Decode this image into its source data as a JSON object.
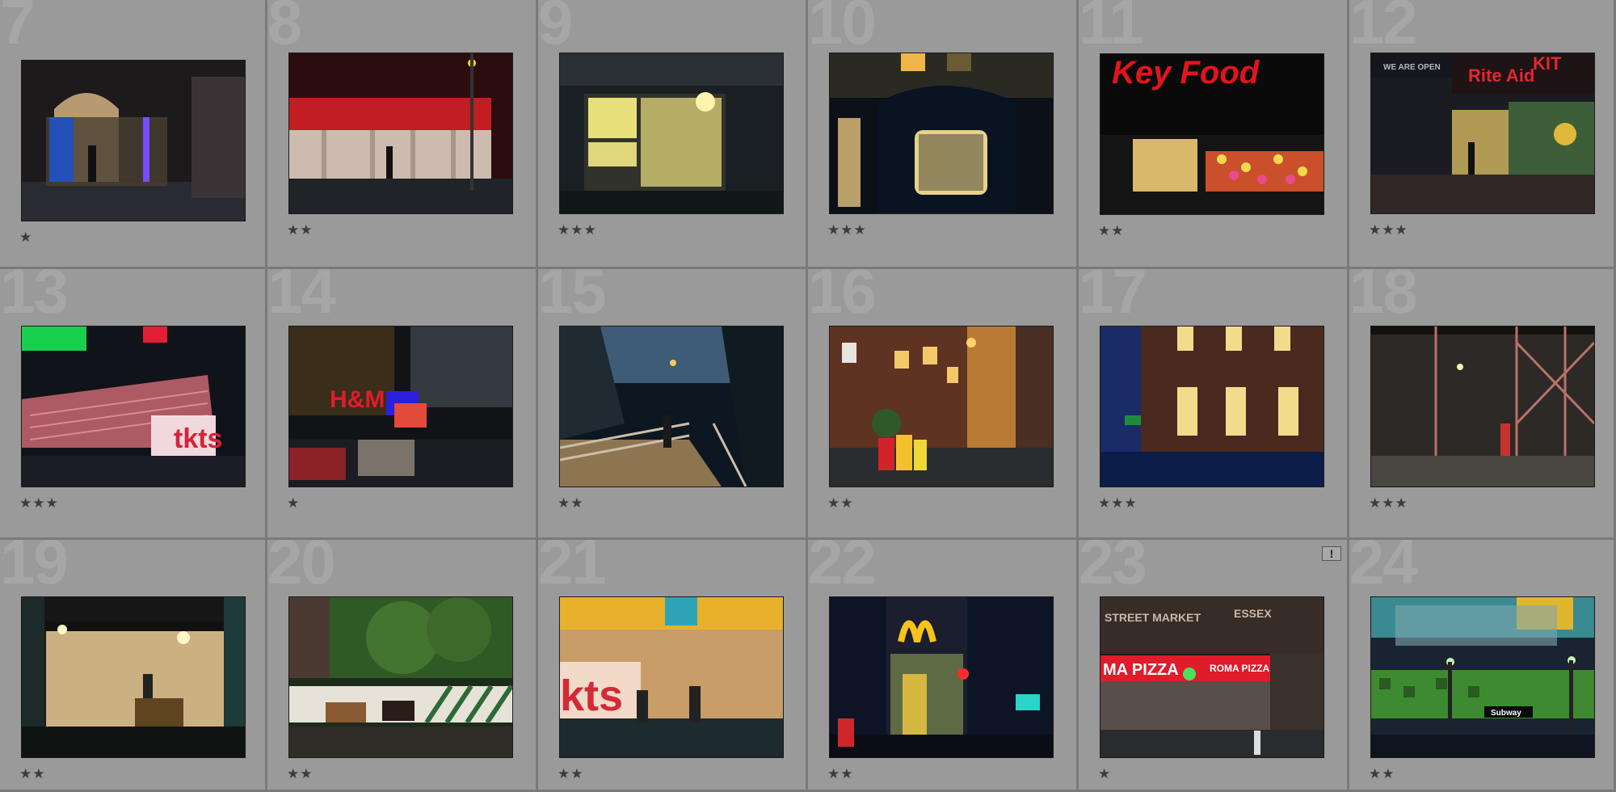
{
  "grid": {
    "rows": [
      {
        "cells": [
          {
            "num": "7",
            "stars": "★",
            "scene": "ticket-booth"
          },
          {
            "num": "8",
            "stars": "★★",
            "scene": "storefront-red"
          },
          {
            "num": "9",
            "stars": "★★★",
            "scene": "lit-doorway"
          },
          {
            "num": "10",
            "stars": "★★★",
            "scene": "bus-window"
          },
          {
            "num": "11",
            "stars": "★★",
            "scene": "key-food",
            "sign": "Key Food"
          },
          {
            "num": "12",
            "stars": "★★★",
            "scene": "rite-aid",
            "sign": "Rite Aid",
            "sign2": "KIT",
            "awning": "WE ARE OPEN"
          }
        ]
      },
      {
        "cells": [
          {
            "num": "13",
            "stars": "★★★",
            "scene": "tkts-stairs",
            "sign": "tkts"
          },
          {
            "num": "14",
            "stars": "★",
            "scene": "hm-street",
            "sign": "H&M"
          },
          {
            "num": "15",
            "stars": "★★",
            "scene": "ramp"
          },
          {
            "num": "16",
            "stars": "★★",
            "scene": "brick-houses"
          },
          {
            "num": "17",
            "stars": "★★★",
            "scene": "blue-building"
          },
          {
            "num": "18",
            "stars": "★★★",
            "scene": "scaffolding"
          }
        ]
      },
      {
        "cells": [
          {
            "num": "19",
            "stars": "★★",
            "scene": "lobby"
          },
          {
            "num": "20",
            "stars": "★★",
            "scene": "horses"
          },
          {
            "num": "21",
            "stars": "★★",
            "scene": "tkts-people",
            "sign": "kts"
          },
          {
            "num": "22",
            "stars": "★★",
            "scene": "mcdonalds"
          },
          {
            "num": "23",
            "stars": "★",
            "scene": "pizza",
            "sign": "MA PIZZA",
            "sign2": "ROMA PIZZA",
            "awning": "STREET MARKET",
            "sign3": "ESSEX",
            "badge": "!"
          },
          {
            "num": "24",
            "stars": "★★",
            "scene": "subway",
            "sign": "Subway"
          }
        ]
      }
    ]
  },
  "colors": {
    "background": "#9a9a9a",
    "border": "#7a7a7a",
    "number": "#a6a6a6",
    "stars": "#3c3c3c"
  }
}
